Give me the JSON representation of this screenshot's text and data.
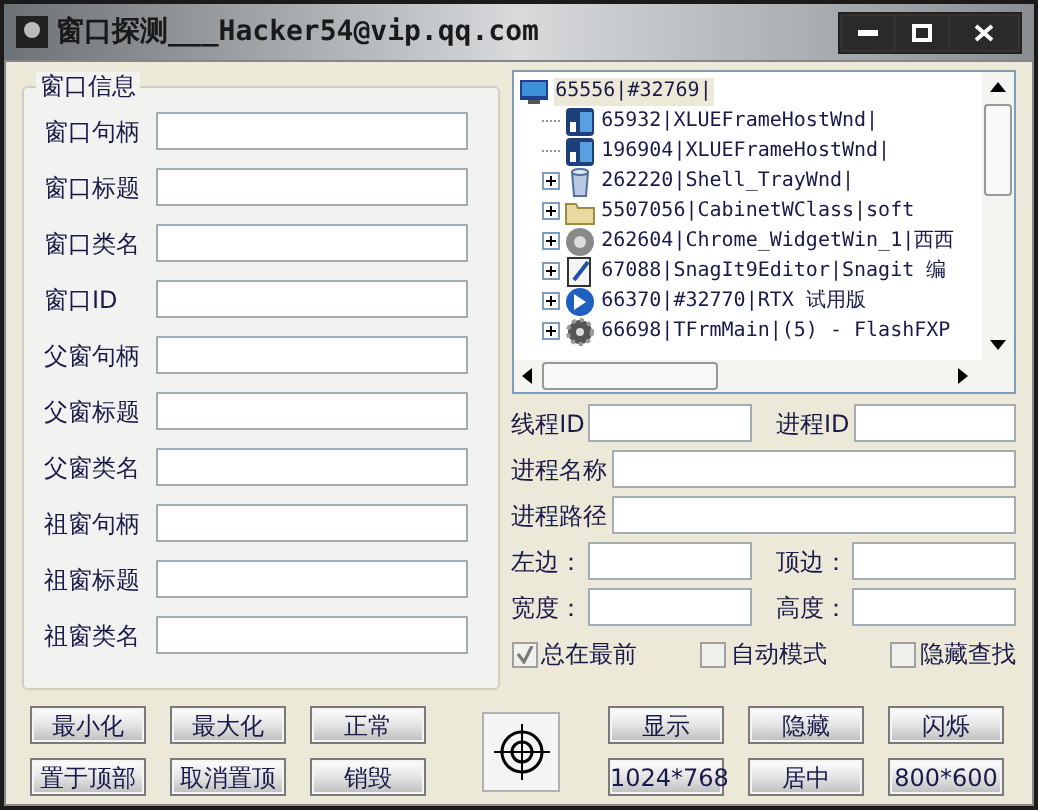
{
  "window": {
    "title": "窗口探测___Hacker54@vip.qq.com"
  },
  "window_info": {
    "title": "窗口信息",
    "fields": [
      {
        "label": "窗口句柄"
      },
      {
        "label": "窗口标题"
      },
      {
        "label": "窗口类名"
      },
      {
        "label": "窗口ID"
      },
      {
        "label": "父窗句柄"
      },
      {
        "label": "父窗标题"
      },
      {
        "label": "父窗类名"
      },
      {
        "label": "祖窗句柄"
      },
      {
        "label": "祖窗标题"
      },
      {
        "label": "祖窗类名"
      }
    ]
  },
  "tree": {
    "items": [
      {
        "label": "65556|#32769|",
        "selected": true,
        "children": [
          {
            "label": "65932|XLUEFrameHostWnd|",
            "kind": "leaf",
            "selected": false
          },
          {
            "label": "196904|XLUEFrameHostWnd|",
            "kind": "leaf",
            "selected": false
          },
          {
            "label": "262220|Shell_TrayWnd|",
            "kind": "collapsed",
            "selected": false
          },
          {
            "label": "5507056|CabinetWClass|soft",
            "kind": "collapsed",
            "selected": false
          },
          {
            "label": "262604|Chrome_WidgetWin_1|西西",
            "kind": "collapsed",
            "selected": false
          },
          {
            "label": "67088|SnagIt9Editor|Snagit 编",
            "kind": "collapsed",
            "selected": false
          },
          {
            "label": "66370|#32770|RTX 试用版",
            "kind": "collapsed",
            "selected": false
          },
          {
            "label": "66698|TFrmMain|(5) - FlashFXP",
            "kind": "collapsed",
            "selected": false
          }
        ]
      }
    ]
  },
  "process": {
    "rows": [
      [
        {
          "label": "线程ID"
        },
        {
          "label": "进程ID"
        }
      ],
      [
        {
          "label": "进程名称"
        }
      ],
      [
        {
          "label": "进程路径"
        }
      ],
      [
        {
          "label": "左边："
        },
        {
          "label": "顶边："
        }
      ],
      [
        {
          "label": "宽度："
        },
        {
          "label": "高度："
        }
      ]
    ]
  },
  "options": [
    {
      "label": "总在最前",
      "checked": true
    },
    {
      "label": "自动模式",
      "checked": false
    },
    {
      "label": "隐藏查找",
      "checked": false
    }
  ],
  "buttons": {
    "left": [
      [
        {
          "label": "最小化"
        },
        {
          "label": "最大化"
        },
        {
          "label": "正常"
        }
      ],
      [
        {
          "label": "置于顶部"
        },
        {
          "label": "取消置顶"
        },
        {
          "label": "销毁"
        }
      ]
    ],
    "right": [
      [
        {
          "label": "显示"
        },
        {
          "label": "隐藏"
        },
        {
          "label": "闪烁"
        }
      ],
      [
        {
          "label": "1024*768"
        },
        {
          "label": "居中"
        },
        {
          "label": "800*600"
        }
      ]
    ]
  }
}
